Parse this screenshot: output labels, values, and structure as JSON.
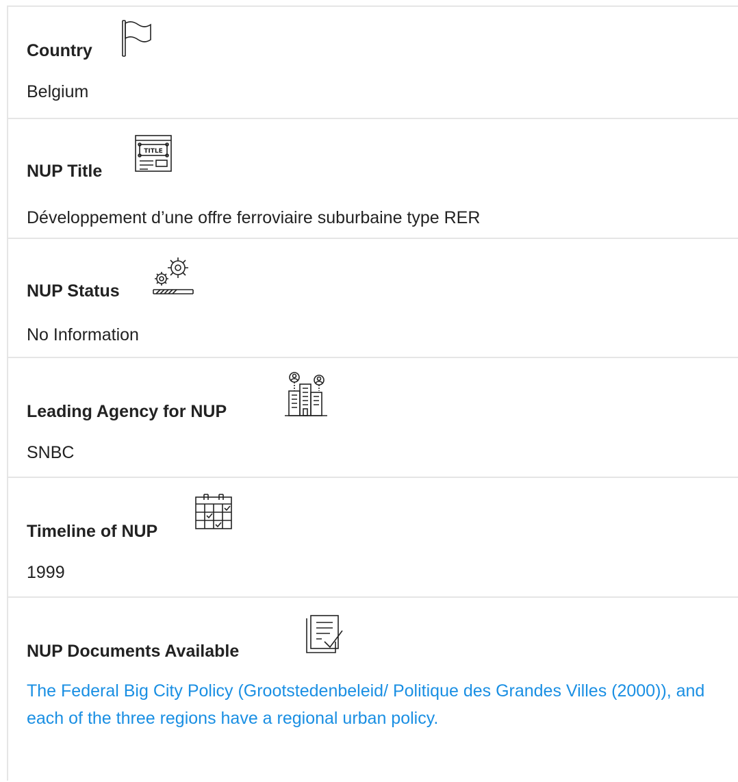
{
  "fields": [
    {
      "label": "Country",
      "value": "Belgium",
      "icon": "flag-icon"
    },
    {
      "label": "NUP Title",
      "value": "Développement d’une offre ferroviaire suburbaine type RER",
      "icon": "title-window-icon"
    },
    {
      "label": "NUP Status",
      "value": "No Information",
      "icon": "gears-progress-icon"
    },
    {
      "label": "Leading Agency for NUP",
      "value": "SNBC",
      "icon": "city-agency-icon"
    },
    {
      "label": "Timeline of NUP",
      "value": "1999",
      "icon": "calendar-icon"
    },
    {
      "label": "NUP Documents Available",
      "value": "The Federal Big City Policy (Grootstedenbeleid/ Politique des Grandes Villes (2000)), and each of the three regions have a regional urban policy.",
      "icon": "document-check-icon"
    }
  ],
  "link_color": "#1a8fe3"
}
